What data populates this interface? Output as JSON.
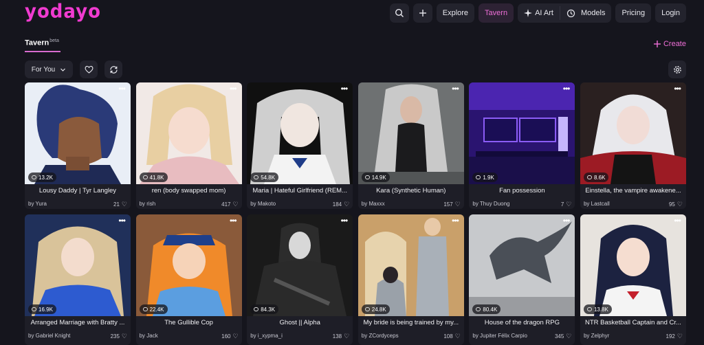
{
  "app": {
    "logo": "yodayo"
  },
  "nav": {
    "search_icon": "search-icon",
    "add_icon": "plus-icon",
    "explore": "Explore",
    "tavern": "Tavern",
    "ai_art": "AI Art",
    "models": "Models",
    "pricing": "Pricing",
    "login": "Login",
    "accent": "#ef6fd8"
  },
  "tabs": {
    "tavern": "Tavern",
    "tavern_badge": "beta",
    "create": "Create"
  },
  "filters": {
    "feed": "For You"
  },
  "cards": [
    {
      "title": "Lousy Daddy | Tyr Langley",
      "author": "by Yura",
      "chats": "13.2K",
      "likes": "21"
    },
    {
      "title": "ren (body swapped mom)",
      "author": "by rish",
      "chats": "41.8K",
      "likes": "417"
    },
    {
      "title": "Maria | Hateful Girlfriend (REM...",
      "author": "by Makoto",
      "chats": "54.8K",
      "likes": "184"
    },
    {
      "title": "Kara (Synthetic Human)",
      "author": "by Maxxx",
      "chats": "14.9K",
      "likes": "157"
    },
    {
      "title": "Fan possession",
      "author": "by Thuy Duong",
      "chats": "1.9K",
      "likes": "7"
    },
    {
      "title": "Einstella, the vampire awakene...",
      "author": "by Lastcall",
      "chats": "8.6K",
      "likes": "95"
    },
    {
      "title": "Arranged Marriage with Bratty ...",
      "author": "by Gabriel Knight",
      "chats": "16.9K",
      "likes": "235"
    },
    {
      "title": "The Gullible Cop",
      "author": "by Jack",
      "chats": "22.4K",
      "likes": "160"
    },
    {
      "title": "Ghost || Alpha",
      "author": "by i_xypma_i",
      "chats": "84.3K",
      "likes": "138"
    },
    {
      "title": "My bride is being trained by my...",
      "author": "by ZCordyceps",
      "chats": "24.8K",
      "likes": "108"
    },
    {
      "title": "House of the dragon RPG",
      "author": "by Jupiter Félix Carpio",
      "chats": "80.4K",
      "likes": "345"
    },
    {
      "title": "NTR Basketball Captain and Cr...",
      "author": "by Zelphyr",
      "chats": "13.8K",
      "likes": "192"
    }
  ]
}
